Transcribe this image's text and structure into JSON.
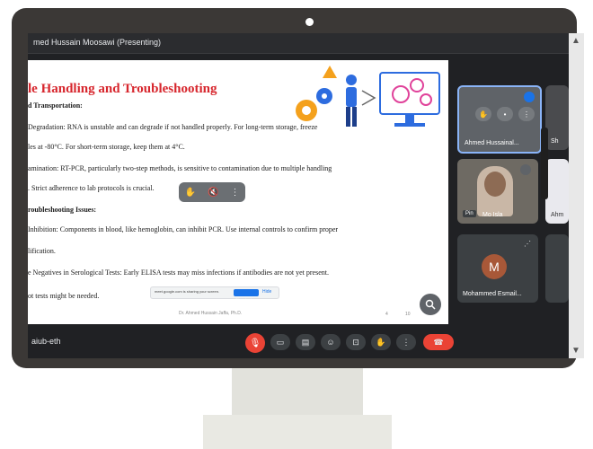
{
  "presenter_banner": "med Hussain Moosawi (Presenting)",
  "slide": {
    "title": "le Handling and Troubleshooting",
    "lines": [
      {
        "text": "d Transportation:",
        "bold": true
      },
      {
        "text": "Degradation: RNA is unstable and can degrade if not handled properly. For long-term storage, freeze",
        "bold": false
      },
      {
        "text": "les at -80°C. For short-term storage, keep them at 4°C.",
        "bold": false
      },
      {
        "text": "amination: RT-PCR, particularly two-step methods, is sensitive to contamination due to multiple handling",
        "bold": false
      },
      {
        "text": ". Strict adherence to lab protocols is crucial.",
        "bold": false
      },
      {
        "text": "roubleshooting Issues:",
        "bold": true
      },
      {
        "text": "Inhibition: Components in blood, like hemoglobin, can inhibit PCR. Use internal controls to confirm proper",
        "bold": false
      },
      {
        "text": "lification.",
        "bold": false
      },
      {
        "text": "e Negatives in Serological Tests: Early ELISA tests may miss infections if antibodies are not yet present.",
        "bold": false
      },
      {
        "text": "ot tests might be needed.",
        "bold": false
      }
    ],
    "share_bar_text": "meet.google.com is sharing your screen.",
    "share_stop": "Stop sharing",
    "share_hide": "Hide",
    "footer_note": "Dr. Ahmed Hussain Jaffa, Ph.D.",
    "page_label_left": "4",
    "page_label_right": "10"
  },
  "participants": [
    {
      "name": "Ahmed Hussainal...",
      "speaking": true
    },
    {
      "name": "Sh",
      "partial": true
    },
    {
      "name": "Mo Isla",
      "badge": "Pin"
    },
    {
      "name": "Ahm",
      "partial": true
    },
    {
      "name": "Mohammed Esmail...",
      "initial": "M"
    }
  ],
  "meeting_code": "aiub-eth",
  "colors": {
    "title_red": "#d7262d",
    "meet_red": "#ea4335",
    "avatar_brown": "#a85838",
    "accent_blue": "#1a73e8"
  }
}
